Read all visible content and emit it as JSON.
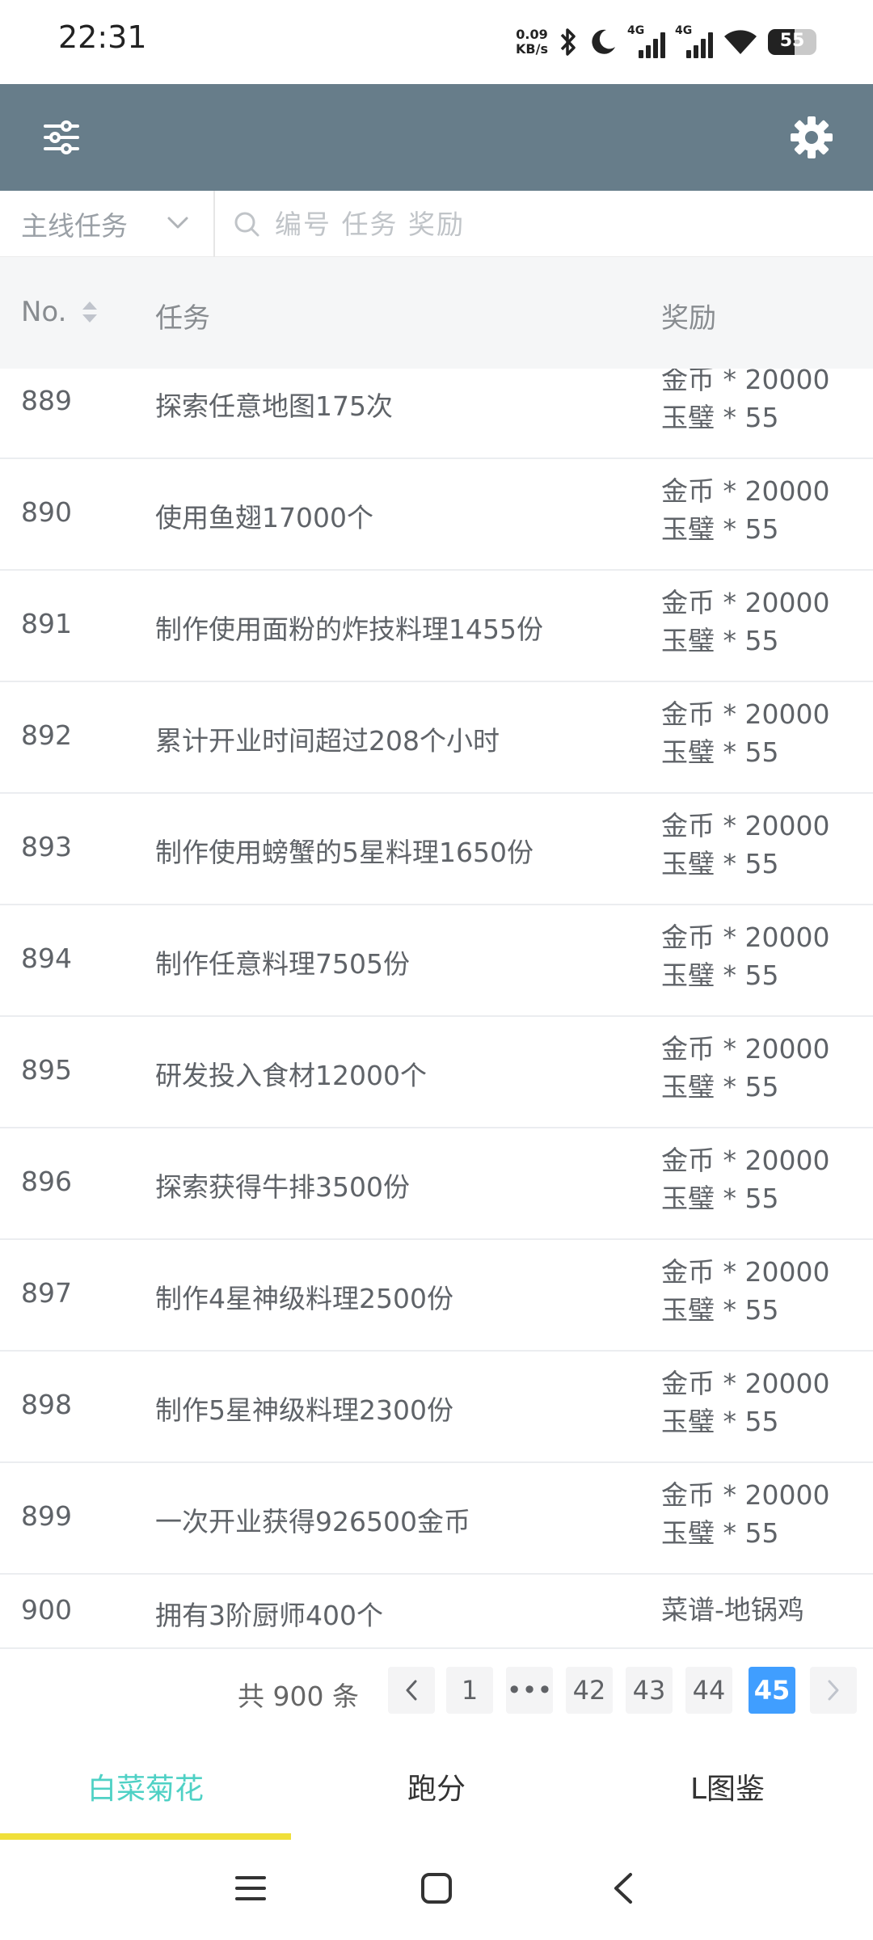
{
  "status_bar": {
    "time": "22:31",
    "net_speed_value": "0.09",
    "net_speed_unit": "KB/s",
    "network_1": "4G",
    "network_2": "4G",
    "battery": "55",
    "icons": [
      "bluetooth-icon",
      "moon-icon",
      "signal-icon",
      "wifi-icon",
      "battery-icon"
    ]
  },
  "header": {
    "left_icon": "sliders-icon",
    "right_icon": "gear-icon",
    "bar_color": "#677d8a"
  },
  "filter": {
    "type_selected": "主线任务",
    "search_placeholder": "编号 任务 奖励"
  },
  "table": {
    "headers": {
      "no": "No.",
      "task": "任务",
      "reward": "奖励"
    },
    "rows": [
      {
        "no": "889",
        "task": "探索任意地图175次",
        "reward1": "金币 * 20000",
        "reward2": "玉璧 * 55"
      },
      {
        "no": "890",
        "task": "使用鱼翅17000个",
        "reward1": "金币 * 20000",
        "reward2": "玉璧 * 55"
      },
      {
        "no": "891",
        "task": "制作使用面粉的炸技料理1455份",
        "reward1": "金币 * 20000",
        "reward2": "玉璧 * 55"
      },
      {
        "no": "892",
        "task": "累计开业时间超过208个小时",
        "reward1": "金币 * 20000",
        "reward2": "玉璧 * 55"
      },
      {
        "no": "893",
        "task": "制作使用螃蟹的5星料理1650份",
        "reward1": "金币 * 20000",
        "reward2": "玉璧 * 55"
      },
      {
        "no": "894",
        "task": "制作任意料理7505份",
        "reward1": "金币 * 20000",
        "reward2": "玉璧 * 55"
      },
      {
        "no": "895",
        "task": "研发投入食材12000个",
        "reward1": "金币 * 20000",
        "reward2": "玉璧 * 55"
      },
      {
        "no": "896",
        "task": "探索获得牛排3500份",
        "reward1": "金币 * 20000",
        "reward2": "玉璧 * 55"
      },
      {
        "no": "897",
        "task": "制作4星神级料理2500份",
        "reward1": "金币 * 20000",
        "reward2": "玉璧 * 55"
      },
      {
        "no": "898",
        "task": "制作5星神级料理2300份",
        "reward1": "金币 * 20000",
        "reward2": "玉璧 * 55"
      },
      {
        "no": "899",
        "task": "一次开业获得926500金币",
        "reward1": "金币 * 20000",
        "reward2": "玉璧 * 55"
      },
      {
        "no": "900",
        "task": "拥有3阶厨师400个",
        "reward1": "菜谱-地锅鸡",
        "reward2": ""
      }
    ]
  },
  "pagination": {
    "total": "共 900 条",
    "pages": [
      "1",
      "•••",
      "42",
      "43",
      "44",
      "45"
    ],
    "current": "45",
    "active_color": "#409eff"
  },
  "tabs": {
    "items": [
      "白菜菊花",
      "跑分",
      "L图鉴"
    ],
    "active_color": "#4fd1c5",
    "indicator_color": "#f0df3a"
  }
}
